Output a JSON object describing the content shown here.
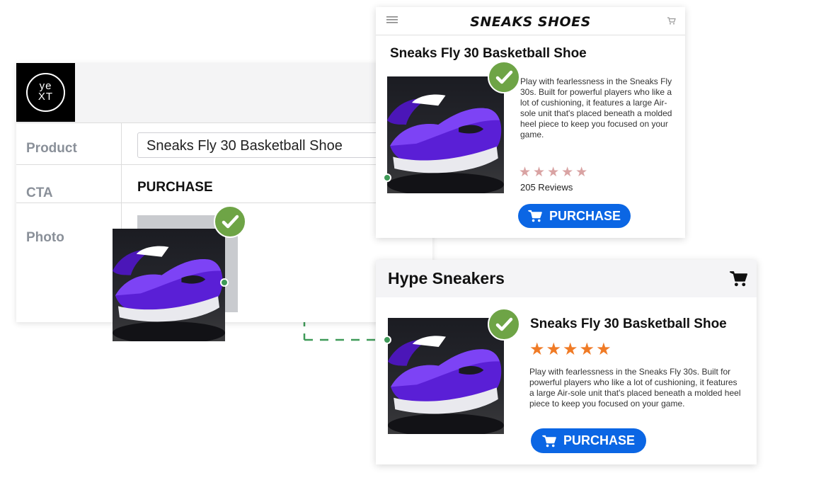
{
  "cms": {
    "logo_line1": "ye",
    "logo_line2": "XT",
    "fields": {
      "product_label": "Product",
      "product_value": "Sneaks Fly 30 Basketball Shoe",
      "cta_label": "CTA",
      "cta_value": "PURCHASE",
      "photo_label": "Photo"
    }
  },
  "mobile_card": {
    "brand": "SNEAKS SHOES",
    "title": "Sneaks Fly 30 Basketball Shoe",
    "description": "Play with fearlessness in the Sneaks Fly 30s. Built for powerful players who like a lot of cushioning, it features a large Air-sole unit that's placed beneath a molded heel piece to keep you focused on your game.",
    "stars": "★★★★★",
    "reviews": "205 Reviews",
    "button_label": "PURCHASE"
  },
  "desktop_card": {
    "store_name": "Hype Sneakers",
    "title": "Sneaks Fly 30 Basketball Shoe",
    "stars": "★★★★★",
    "description": "Play with fearlessness in the Sneaks Fly 30s. Built for powerful players who like a lot of cushioning, it features a large Air-sole unit that's placed beneath a molded heel piece to keep you focused on your game.",
    "button_label": "PURCHASE"
  },
  "colors": {
    "accent_green": "#6ea446",
    "connector_green": "#3f9a58",
    "button_blue": "#0b66e4",
    "star_orange": "#f07b26",
    "star_grey": "#d9a3a3"
  },
  "icons": [
    "yext-logo",
    "check-icon",
    "hamburger-menu-icon",
    "cart-icon"
  ]
}
